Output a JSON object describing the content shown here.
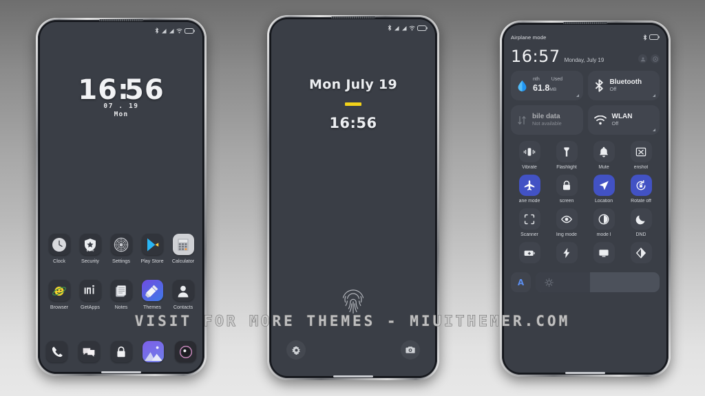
{
  "watermark": "VISIT FOR MORE THEMES - MIUITHEMER.COM",
  "theme": {
    "screen_bg": "#3a3e46",
    "tile_bg": "#40444d",
    "accent_blue": "#4252c4",
    "accent_yellow": "#f2d21a",
    "text_primary": "#f0f1f3",
    "text_secondary": "#b6bac1"
  },
  "phone1": {
    "name": "home-screen",
    "status_bar": {
      "icons": [
        "bluetooth-icon",
        "signal-icon",
        "signal-icon",
        "wifi-icon",
        "battery-icon"
      ]
    },
    "clock": {
      "hours": "16",
      "separator": ":",
      "minutes": "56",
      "date": "07 . 19",
      "day": "Mon"
    },
    "apps_row1": [
      {
        "label": "Clock",
        "icon": "clock-icon"
      },
      {
        "label": "Security",
        "icon": "security-shield-icon",
        "badge": "80%"
      },
      {
        "label": "Settings",
        "icon": "settings-gear-icon"
      },
      {
        "label": "Play Store",
        "icon": "play-store-icon"
      },
      {
        "label": "Calculator",
        "icon": "calculator-icon"
      }
    ],
    "apps_row2": [
      {
        "label": "Browser",
        "icon": "browser-icon"
      },
      {
        "label": "GetApps",
        "icon": "getapps-mi-icon"
      },
      {
        "label": "Notes",
        "icon": "notes-icon"
      },
      {
        "label": "Themes",
        "icon": "themes-brush-icon"
      },
      {
        "label": "Contacts",
        "icon": "contacts-person-icon"
      }
    ],
    "dock": [
      {
        "label": "Phone",
        "icon": "phone-handset-icon"
      },
      {
        "label": "Messages",
        "icon": "messages-bubble-icon"
      },
      {
        "label": "Security Lock",
        "icon": "lock-icon"
      },
      {
        "label": "Gallery",
        "icon": "gallery-image-icon"
      },
      {
        "label": "Camera",
        "icon": "camera-lens-icon"
      }
    ]
  },
  "phone2": {
    "name": "lock-screen",
    "status_bar": {
      "icons": [
        "bluetooth-icon",
        "signal-icon",
        "signal-icon",
        "wifi-icon",
        "battery-icon"
      ]
    },
    "date": "Mon July 19",
    "time": "16:56",
    "fingerprint_hint": "fingerprint-icon",
    "shortcut_left": "settings-gear-icon",
    "shortcut_right": "camera-icon"
  },
  "phone3": {
    "name": "control-center",
    "airplane_label": "Airplane mode",
    "status_icons": [
      "bluetooth-icon",
      "battery-icon"
    ],
    "time": "16:57",
    "date": "Monday, July 19",
    "header_buttons": [
      "user-icon",
      "settings-gear-icon"
    ],
    "big_tiles": [
      {
        "name": "data-usage",
        "kind": "usage",
        "top_left": "nth",
        "top_right": "Used",
        "value": "61.8",
        "unit": "MB",
        "icon": "data-drop-icon",
        "state": "on"
      },
      {
        "name": "mobile-data",
        "kind": "plain",
        "title": "bile data",
        "sub": "Not available",
        "icon": "mobile-data-icon",
        "state": "disabled"
      },
      {
        "name": "bluetooth",
        "kind": "plain",
        "title": "Bluetooth",
        "sub": "Off",
        "icon": "bluetooth-icon",
        "state": "off"
      },
      {
        "name": "wlan",
        "kind": "plain",
        "title": "WLAN",
        "sub": "Off",
        "icon": "wifi-icon",
        "state": "off"
      }
    ],
    "toggles": [
      {
        "label": "Vibrate",
        "icon": "vibrate-icon",
        "on": false
      },
      {
        "label": "Flashlight",
        "icon": "flashlight-icon",
        "on": false
      },
      {
        "label": "Mute",
        "icon": "bell-mute-icon",
        "on": false
      },
      {
        "label": "enshot",
        "icon": "screenshot-icon",
        "on": false
      },
      {
        "label": "ane mode",
        "icon": "airplane-icon",
        "on": true
      },
      {
        "label": "screen",
        "icon": "lock-icon",
        "on": false
      },
      {
        "label": "Location",
        "icon": "location-arrow-icon",
        "on": true
      },
      {
        "label": "Rotate off",
        "icon": "rotate-lock-icon",
        "on": true
      },
      {
        "label": "Scanner",
        "icon": "scanner-icon",
        "on": false
      },
      {
        "label": "ling mode",
        "icon": "reading-eye-icon",
        "on": false
      },
      {
        "label": "mode      l",
        "icon": "dark-mode-icon",
        "on": false
      },
      {
        "label": "DND",
        "icon": "moon-dnd-icon",
        "on": false
      },
      {
        "label": "",
        "icon": "battery-saver-icon",
        "on": false
      },
      {
        "label": "",
        "icon": "ultra-saver-bolt-icon",
        "on": false
      },
      {
        "label": "",
        "icon": "cast-screen-icon",
        "on": false
      },
      {
        "label": "",
        "icon": "contrast-icon",
        "on": false
      }
    ],
    "brightness": {
      "auto_label": "A",
      "icon": "brightness-sun-icon",
      "level_percent": 44
    }
  }
}
